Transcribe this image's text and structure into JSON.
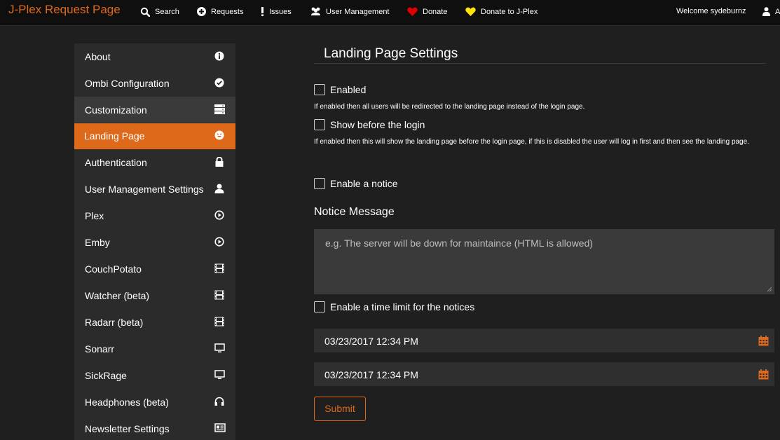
{
  "app": {
    "brand": "J-Plex Request Page",
    "accent": "#df691a"
  },
  "navbar": {
    "items": [
      {
        "label": "Search",
        "icon": "search-icon"
      },
      {
        "label": "Requests",
        "icon": "plus-circle-icon"
      },
      {
        "label": "Issues",
        "icon": "exclamation-icon"
      },
      {
        "label": "User Management",
        "icon": "users-icon"
      },
      {
        "label": "Donate",
        "icon": "heart-icon",
        "icon_color": "#e00000"
      },
      {
        "label": "Donate to J-Plex",
        "icon": "heart-icon",
        "icon_color": "#ffe600"
      },
      {
        "label": "Welcome sydeburnz",
        "icon": ""
      },
      {
        "label": "A",
        "icon": "user-icon"
      }
    ]
  },
  "sidebar": {
    "items": [
      {
        "label": "About",
        "icon": "info-icon"
      },
      {
        "label": "Ombi Configuration",
        "icon": "check-circle-icon"
      },
      {
        "label": "Customization",
        "icon": "server-icon"
      },
      {
        "label": "Landing Page",
        "icon": "smiley-icon"
      },
      {
        "label": "Authentication",
        "icon": "lock-icon"
      },
      {
        "label": "User Management Settings",
        "icon": "user-icon"
      },
      {
        "label": "Plex",
        "icon": "play-circle-icon"
      },
      {
        "label": "Emby",
        "icon": "play-circle-icon"
      },
      {
        "label": "CouchPotato",
        "icon": "film-icon"
      },
      {
        "label": "Watcher (beta)",
        "icon": "film-icon"
      },
      {
        "label": "Radarr (beta)",
        "icon": "film-icon"
      },
      {
        "label": "Sonarr",
        "icon": "monitor-icon"
      },
      {
        "label": "SickRage",
        "icon": "monitor-icon"
      },
      {
        "label": "Headphones (beta)",
        "icon": "headphones-icon"
      },
      {
        "label": "Newsletter Settings",
        "icon": "newspaper-icon"
      }
    ],
    "active": "Landing Page",
    "hovered": "Customization"
  },
  "main": {
    "title": "Landing Page Settings",
    "enabled": {
      "label": "Enabled",
      "checked": false,
      "help": "If enabled then all users will be redirected to the landing page instead of the login page."
    },
    "before_login": {
      "label": "Show before the login",
      "checked": false,
      "help": "If enabled then this will show the landing page before the login page, if this is disabled the user will log in first and then see the landing page."
    },
    "notice": {
      "label": "Enable a notice",
      "checked": false
    },
    "notice_message": {
      "label": "Notice Message",
      "placeholder": "e.g. The server will be down for maintaince (HTML is allowed)"
    },
    "time_limit": {
      "label": "Enable a time limit for the notices",
      "checked": false
    },
    "start_date": "03/23/2017 12:34 PM",
    "end_date": "03/23/2017 12:34 PM",
    "submit_label": "Submit"
  }
}
